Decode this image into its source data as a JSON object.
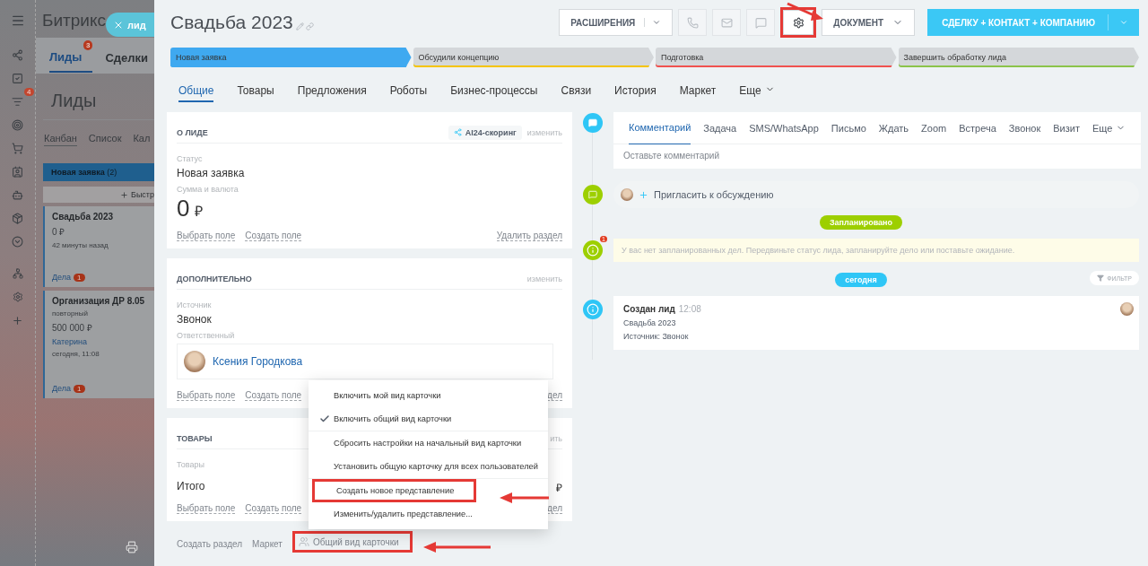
{
  "sidebar": {
    "counter": "4"
  },
  "background_page": {
    "logo": "Битрикс",
    "tabs": [
      {
        "label": "Лиды",
        "badge": "3",
        "selected": true
      },
      {
        "label": "Сделки",
        "selected": false
      }
    ],
    "title": "Лиды",
    "views": [
      {
        "label": "Канбан",
        "selected": true
      },
      {
        "label": "Список",
        "selected": false
      },
      {
        "label": "Кал",
        "selected": false
      }
    ],
    "column": {
      "name": "Новая заявка",
      "count": "(2)"
    },
    "quick_add": "Быстр",
    "cards": [
      {
        "title": "Свадьба 2023",
        "amount": "0 ₽",
        "time": "42 минуты назад",
        "deals": "Дела",
        "deals_count": "1"
      },
      {
        "title": "Организация ДР 8.05",
        "tag": "повторный",
        "amount": "500 000 ₽",
        "person": "Катерина",
        "time": "сегодня, 11:08",
        "deals": "Дела",
        "deals_count": "1"
      }
    ]
  },
  "close_pill": {
    "label": "лид"
  },
  "lead": {
    "title": "Свадьба 2023",
    "extensions_button": "РАСШИРЕНИЯ",
    "icon_buttons": [
      {
        "disabled": true,
        "highlighted": false
      },
      {
        "disabled": true,
        "highlighted": false
      },
      {
        "disabled": true,
        "highlighted": false
      },
      {
        "disabled": false,
        "highlighted": true
      }
    ],
    "document_button": "ДОКУМЕНТ",
    "convert_button": "СДЕЛКУ + КОНТАКТ + КОМПАНИЮ",
    "stages": [
      {
        "label": "Новая заявка",
        "color": "#3fa9f0",
        "selected": true
      },
      {
        "label": "Обсудили концепцию",
        "color": "#f5c400",
        "selected": false
      },
      {
        "label": "Подготовка",
        "color": "#f0524f",
        "selected": false
      },
      {
        "label": "Завершить обработку лида",
        "color": "#8bc34a",
        "selected": false
      }
    ],
    "tabs": [
      {
        "label": "Общие",
        "selected": true
      },
      {
        "label": "Товары",
        "selected": false
      },
      {
        "label": "Предложения",
        "selected": false
      },
      {
        "label": "Роботы",
        "selected": false
      },
      {
        "label": "Бизнес-процессы",
        "selected": false
      },
      {
        "label": "Связи",
        "selected": false
      },
      {
        "label": "История",
        "selected": false
      },
      {
        "label": "Маркет",
        "selected": false
      },
      {
        "label": "Еще",
        "selected": false
      }
    ],
    "sections": [
      {
        "title": "О ЛИДЕ",
        "badge": "AI24-скоринг",
        "action": "изменить",
        "fields": [
          {
            "kind": "text",
            "label": "Статус",
            "value": "Новая заявка"
          },
          {
            "kind": "money",
            "label": "Сумма и валюта",
            "value": "0",
            "currency": "₽"
          }
        ],
        "links": [
          "Выбрать поле",
          "Создать поле"
        ],
        "right_link": "Удалить раздел"
      },
      {
        "title": "ДОПОЛНИТЕЛЬНО",
        "action": "изменить",
        "fields": [
          {
            "kind": "text",
            "label": "Источник",
            "value": "Звонок"
          },
          {
            "kind": "user",
            "label": "Ответственный",
            "value": "Ксения Городкова"
          }
        ],
        "links": [
          "Выбрать поле",
          "Создать поле"
        ],
        "right_link": "дел"
      },
      {
        "title": "ТОВАРЫ",
        "action": "ить",
        "fields": [
          {
            "kind": "label",
            "label": "Товары"
          },
          {
            "kind": "total",
            "label": "Итого",
            "value": "₽"
          }
        ],
        "links": [
          "Выбрать поле",
          "Создать поле"
        ],
        "right_link": "дел"
      }
    ],
    "footer": [
      {
        "label": "Создать раздел",
        "kind": "link",
        "highlighted": false
      },
      {
        "label": "Маркет",
        "kind": "link",
        "highlighted": false
      },
      {
        "label": "Общий вид карточки",
        "kind": "view",
        "highlighted": true
      }
    ],
    "menu": {
      "groups": [
        [
          {
            "label": "Включить мой вид карточки",
            "checked": false,
            "highlighted": false
          },
          {
            "label": "Включить общий вид карточки",
            "checked": true,
            "highlighted": false
          }
        ],
        [
          {
            "label": "Сбросить настройки на начальный вид карточки",
            "checked": false,
            "highlighted": false
          },
          {
            "label": "Установить общую карточку для всех пользователей",
            "checked": false,
            "highlighted": false
          }
        ],
        [
          {
            "label": "Создать новое представление",
            "checked": false,
            "highlighted": true
          },
          {
            "label": "Изменить/удалить представление...",
            "checked": false,
            "highlighted": false
          }
        ]
      ]
    },
    "timeline": {
      "composer": {
        "tabs": [
          {
            "label": "Комментарий",
            "selected": true
          },
          {
            "label": "Задача",
            "selected": false
          },
          {
            "label": "SMS/WhatsApp",
            "selected": false
          },
          {
            "label": "Письмо",
            "selected": false
          },
          {
            "label": "Ждать",
            "selected": false
          },
          {
            "label": "Zoom",
            "selected": false
          },
          {
            "label": "Встреча",
            "selected": false
          },
          {
            "label": "Звонок",
            "selected": false
          },
          {
            "label": "Визит",
            "selected": false
          }
        ],
        "more": "Еще",
        "placeholder": "Оставьте комментарий"
      },
      "invite": "Пригласить к обсуждению",
      "planned_label": "Запланировано",
      "notice": {
        "text": "У вас нет запланированных дел. Передвиньте статус лида, запланируйте дело или поставьте ожидание.",
        "badge": "1"
      },
      "today_label": "сегодня",
      "filter": "ФИЛЬТР",
      "entries": [
        {
          "title": "Создан лид",
          "time": "12:08",
          "lines": [
            "Свадьба 2023",
            "Источник: Звонок"
          ]
        }
      ]
    }
  }
}
